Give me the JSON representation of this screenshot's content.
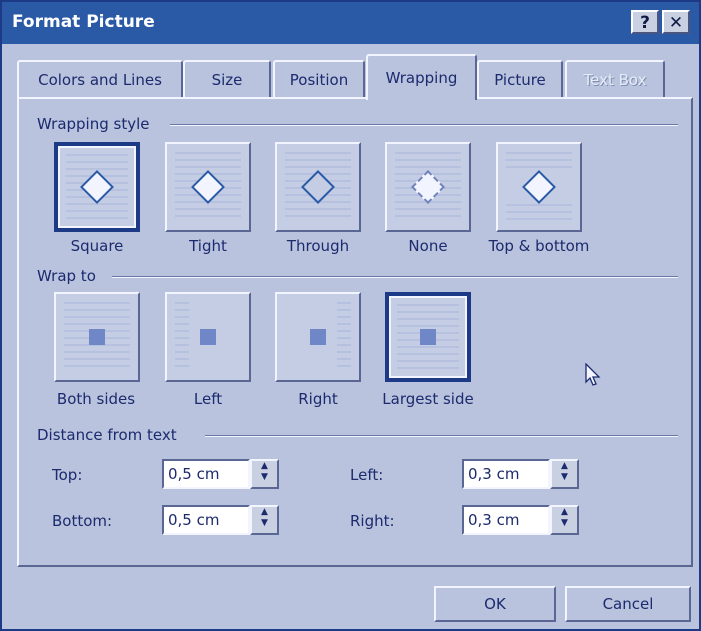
{
  "window": {
    "title": "Format Picture",
    "help_glyph": "?",
    "close_glyph": "✕"
  },
  "tabs": [
    "Colors and Lines",
    "Size",
    "Position",
    "Wrapping",
    "Picture",
    "Text Box"
  ],
  "active_tab": "Wrapping",
  "wrapping_style": {
    "heading": "Wrapping style",
    "options": [
      {
        "label": "Square",
        "selected": true
      },
      {
        "label": "Tight",
        "selected": false
      },
      {
        "label": "Through",
        "selected": false
      },
      {
        "label": "None",
        "selected": false
      },
      {
        "label": "Top & bottom",
        "selected": false
      }
    ]
  },
  "wrap_to": {
    "heading": "Wrap to",
    "options": [
      {
        "label": "Both sides",
        "selected": false
      },
      {
        "label": "Left",
        "selected": false
      },
      {
        "label": "Right",
        "selected": false
      },
      {
        "label": "Largest side",
        "selected": true
      }
    ]
  },
  "distance": {
    "heading": "Distance from text",
    "top_label": "Top:",
    "top_value": "0,5 cm",
    "bottom_label": "Bottom:",
    "bottom_value": "0,5 cm",
    "left_label": "Left:",
    "left_value": "0,3 cm",
    "right_label": "Right:",
    "right_value": "0,3 cm",
    "spin_up": "▲",
    "spin_down": "▼"
  },
  "buttons": {
    "ok": "OK",
    "cancel": "Cancel"
  },
  "colors": {
    "titlebar": "#2a5aa6",
    "face": "#b9c3dd",
    "accent": "#1d3a86"
  }
}
